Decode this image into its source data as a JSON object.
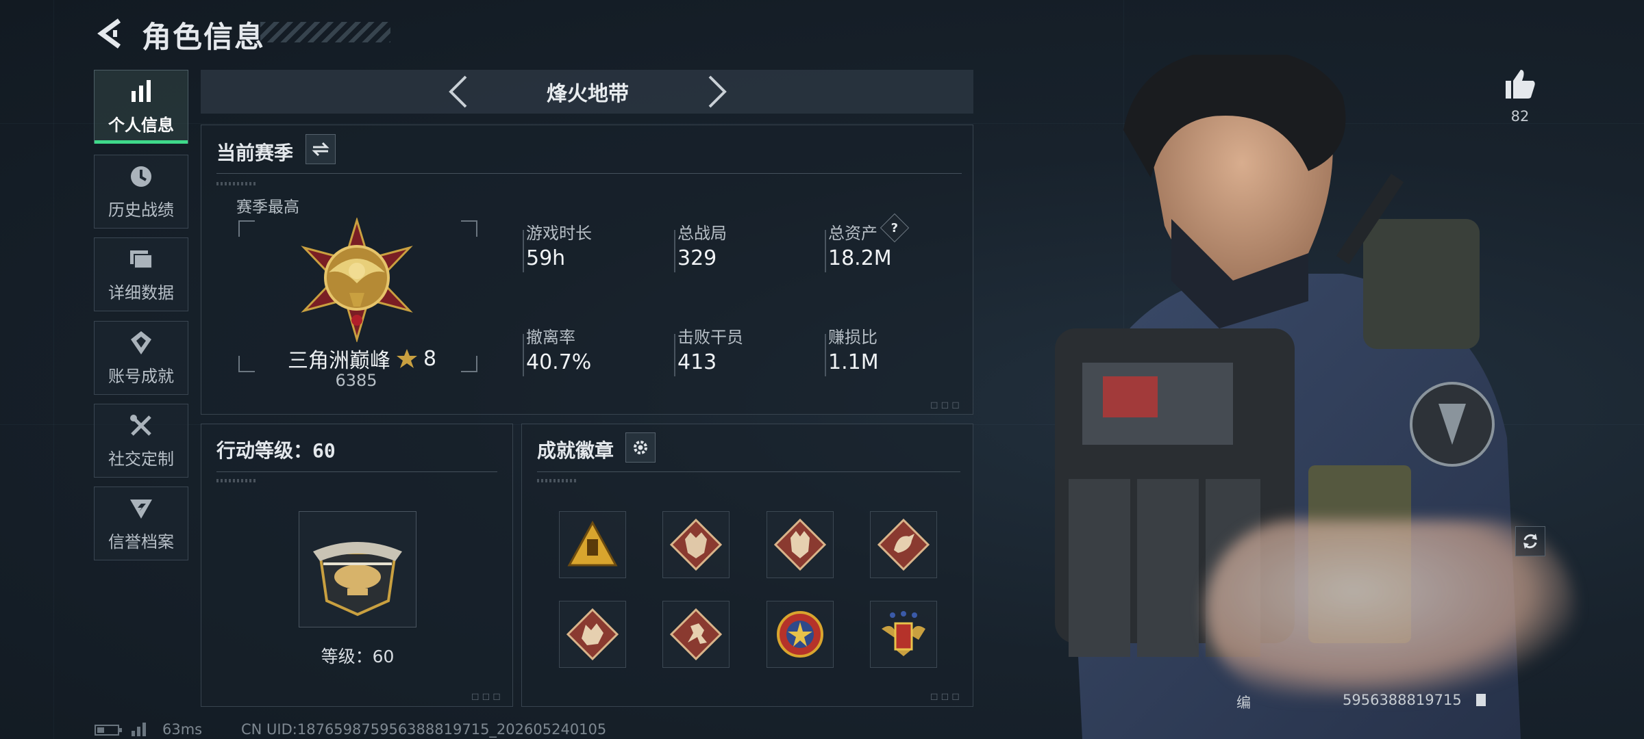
{
  "header": {
    "title": "角色信息"
  },
  "nav": {
    "items": [
      {
        "label": "个人信息",
        "icon": "bar-chart-icon",
        "active": true
      },
      {
        "label": "历史战绩",
        "icon": "clock-icon",
        "active": false
      },
      {
        "label": "详细数据",
        "icon": "folders-icon",
        "active": false
      },
      {
        "label": "账号成就",
        "icon": "achievement-icon",
        "active": false
      },
      {
        "label": "社交定制",
        "icon": "tools-icon",
        "active": false
      },
      {
        "label": "信誉档案",
        "icon": "shield-icon",
        "active": false
      }
    ]
  },
  "mode_tabs": {
    "current": "烽火地带"
  },
  "season": {
    "title": "当前赛季",
    "best_label": "赛季最高",
    "rank_name": "三角洲巅峰",
    "rank_stars": "8",
    "rank_score": "6385",
    "stats": [
      {
        "label": "游戏时长",
        "value": "59h"
      },
      {
        "label": "总战局",
        "value": "329"
      },
      {
        "label": "总资产",
        "value": "18.2M"
      },
      {
        "label": "撤离率",
        "value": "40.7%"
      },
      {
        "label": "击败干员",
        "value": "413"
      },
      {
        "label": "赚损比",
        "value": "1.1M"
      }
    ],
    "help_glyph": "?"
  },
  "action_level": {
    "title": "行动等级：60",
    "level_text": "等级：60"
  },
  "achievements": {
    "title": "成就徽章",
    "badges": [
      "warning-triangle-badge",
      "wolf-badge",
      "wolf-badge-2",
      "bird-badge",
      "dragon-badge",
      "runner-badge",
      "star-emblem-badge",
      "winged-crest-badge"
    ]
  },
  "likes": {
    "count": "82"
  },
  "footer": {
    "ping": "63ms",
    "uid": "CN UID:18765987595638881971​5_202605240105"
  },
  "character": {
    "id_prefix": "编",
    "id_suffix": "5956388819715"
  },
  "colors": {
    "accent": "#3fd98a",
    "panel_border": "#38444f",
    "gold": "#c9a040"
  }
}
